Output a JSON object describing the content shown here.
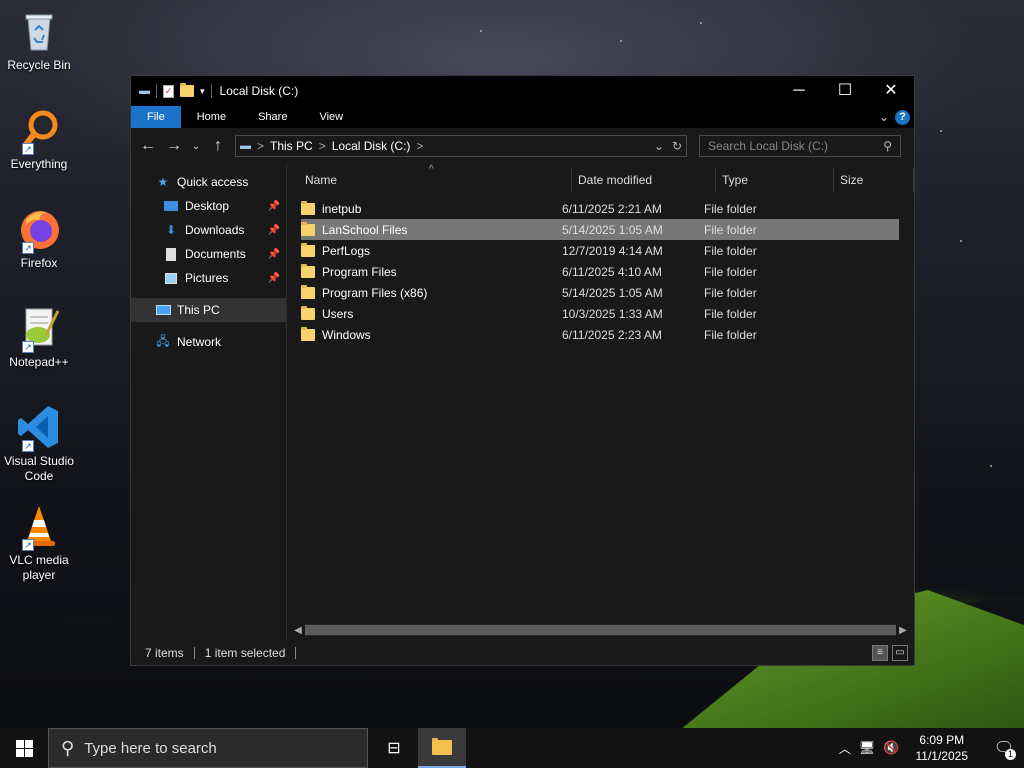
{
  "desktop": {
    "icons": [
      {
        "label": "Recycle Bin"
      },
      {
        "label": "Everything"
      },
      {
        "label": "Firefox"
      },
      {
        "label": "Notepad++"
      },
      {
        "label": "Visual Studio Code"
      },
      {
        "label": "VLC media player"
      }
    ]
  },
  "window": {
    "title": "Local Disk (C:)",
    "controls": {
      "minimize": "─",
      "maximize": "☐",
      "close": "✕"
    },
    "ribbon_tabs": [
      "File",
      "Home",
      "Share",
      "View"
    ],
    "help_label": "?",
    "address": {
      "crumbs": [
        "This PC",
        "Local Disk (C:)"
      ],
      "separator": ">"
    },
    "search_placeholder": "Search Local Disk (C:)",
    "nav_pane": {
      "quick_access": "Quick access",
      "items": [
        {
          "label": "Desktop",
          "pinned": true
        },
        {
          "label": "Downloads",
          "pinned": true
        },
        {
          "label": "Documents",
          "pinned": true
        },
        {
          "label": "Pictures",
          "pinned": true
        }
      ],
      "this_pc": "This PC",
      "network": "Network"
    },
    "columns": {
      "name": "Name",
      "date": "Date modified",
      "type": "Type",
      "size": "Size"
    },
    "files": [
      {
        "name": "inetpub",
        "date": "6/11/2025 2:21 AM",
        "type": "File folder",
        "selected": false
      },
      {
        "name": "LanSchool Files",
        "date": "5/14/2025 1:05 AM",
        "type": "File folder",
        "selected": true
      },
      {
        "name": "PerfLogs",
        "date": "12/7/2019 4:14 AM",
        "type": "File folder",
        "selected": false
      },
      {
        "name": "Program Files",
        "date": "6/11/2025 4:10 AM",
        "type": "File folder",
        "selected": false
      },
      {
        "name": "Program Files (x86)",
        "date": "5/14/2025 1:05 AM",
        "type": "File folder",
        "selected": false
      },
      {
        "name": "Users",
        "date": "10/3/2025 1:33 AM",
        "type": "File folder",
        "selected": false
      },
      {
        "name": "Windows",
        "date": "6/11/2025 2:23 AM",
        "type": "File folder",
        "selected": false
      }
    ],
    "status": {
      "count": "7 items",
      "selection": "1 item selected"
    }
  },
  "taskbar": {
    "search_placeholder": "Type here to search",
    "time": "6:09 PM",
    "date": "11/1/2025",
    "notification_count": "1"
  },
  "colors": {
    "accent": "#1a73c9",
    "selected_row": "#777777",
    "folder": "#f7d36b"
  }
}
